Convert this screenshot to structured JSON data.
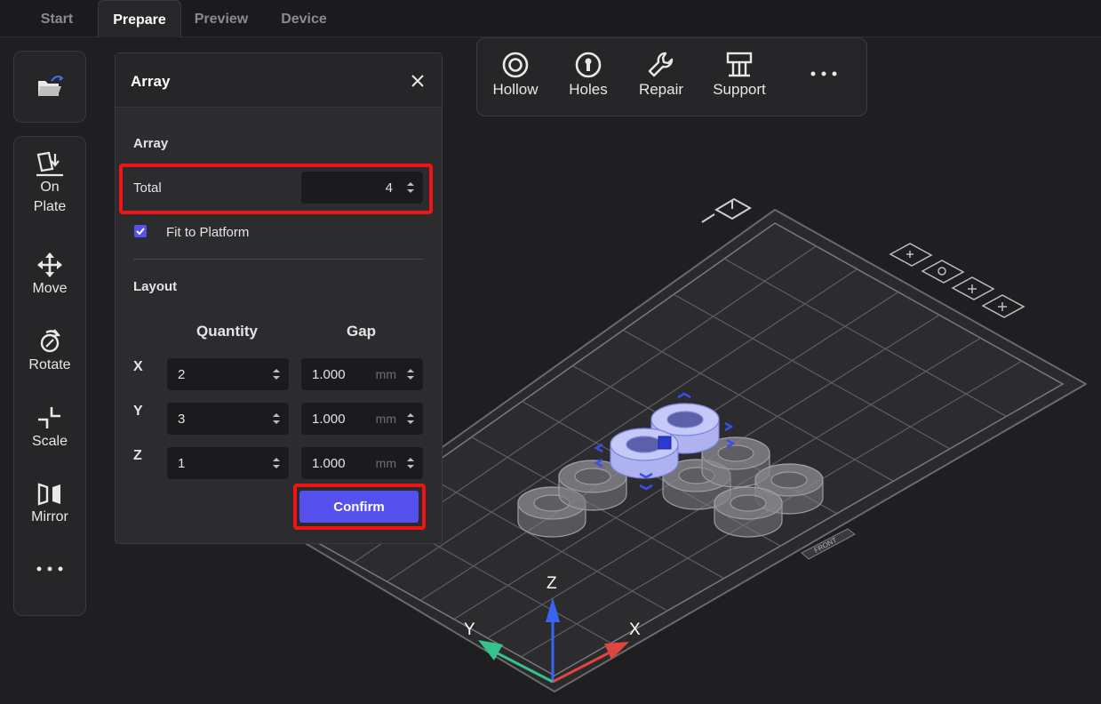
{
  "tabs": [
    {
      "label": "Start"
    },
    {
      "label": "Prepare"
    },
    {
      "label": "Preview"
    },
    {
      "label": "Device"
    }
  ],
  "sidebar": {
    "items": [
      {
        "label_line1": "On",
        "label_line2": "Plate",
        "icon": "on-plate-icon"
      },
      {
        "label": "Move",
        "icon": "move-icon"
      },
      {
        "label": "Rotate",
        "icon": "rotate-icon"
      },
      {
        "label": "Scale",
        "icon": "scale-icon"
      },
      {
        "label": "Mirror",
        "icon": "mirror-icon"
      }
    ],
    "more_icon": "more-horizontal-icon",
    "open_icon": "open-folder-icon"
  },
  "toolbar": {
    "items": [
      {
        "label": "Hollow",
        "icon": "hollow-icon"
      },
      {
        "label": "Holes",
        "icon": "holes-icon"
      },
      {
        "label": "Repair",
        "icon": "wrench-icon"
      },
      {
        "label": "Support",
        "icon": "support-icon"
      }
    ],
    "more_icon": "more-horizontal-icon"
  },
  "dialog": {
    "title": "Array",
    "close_icon": "close-icon",
    "section_array": "Array",
    "total_label": "Total",
    "total_value": "4",
    "fit_label": "Fit to Platform",
    "fit_checked": true,
    "section_layout": "Layout",
    "col_quantity": "Quantity",
    "col_gap": "Gap",
    "rows": [
      {
        "axis": "X",
        "quantity": "2",
        "gap": "1.000",
        "unit": "mm"
      },
      {
        "axis": "Y",
        "quantity": "3",
        "gap": "1.000",
        "unit": "mm"
      },
      {
        "axis": "Z",
        "quantity": "1",
        "gap": "1.000",
        "unit": "mm"
      }
    ],
    "confirm_label": "Confirm"
  },
  "scene": {
    "axis_x": "X",
    "axis_y": "Y",
    "axis_z": "Z",
    "front_label": "FRONT"
  },
  "colors": {
    "accent": "#5650ee",
    "highlight": "#f01414",
    "axis_x": "#e0453f",
    "axis_y": "#34c38f",
    "axis_z": "#3c63f0",
    "selected_model": "#b9bdf4"
  }
}
